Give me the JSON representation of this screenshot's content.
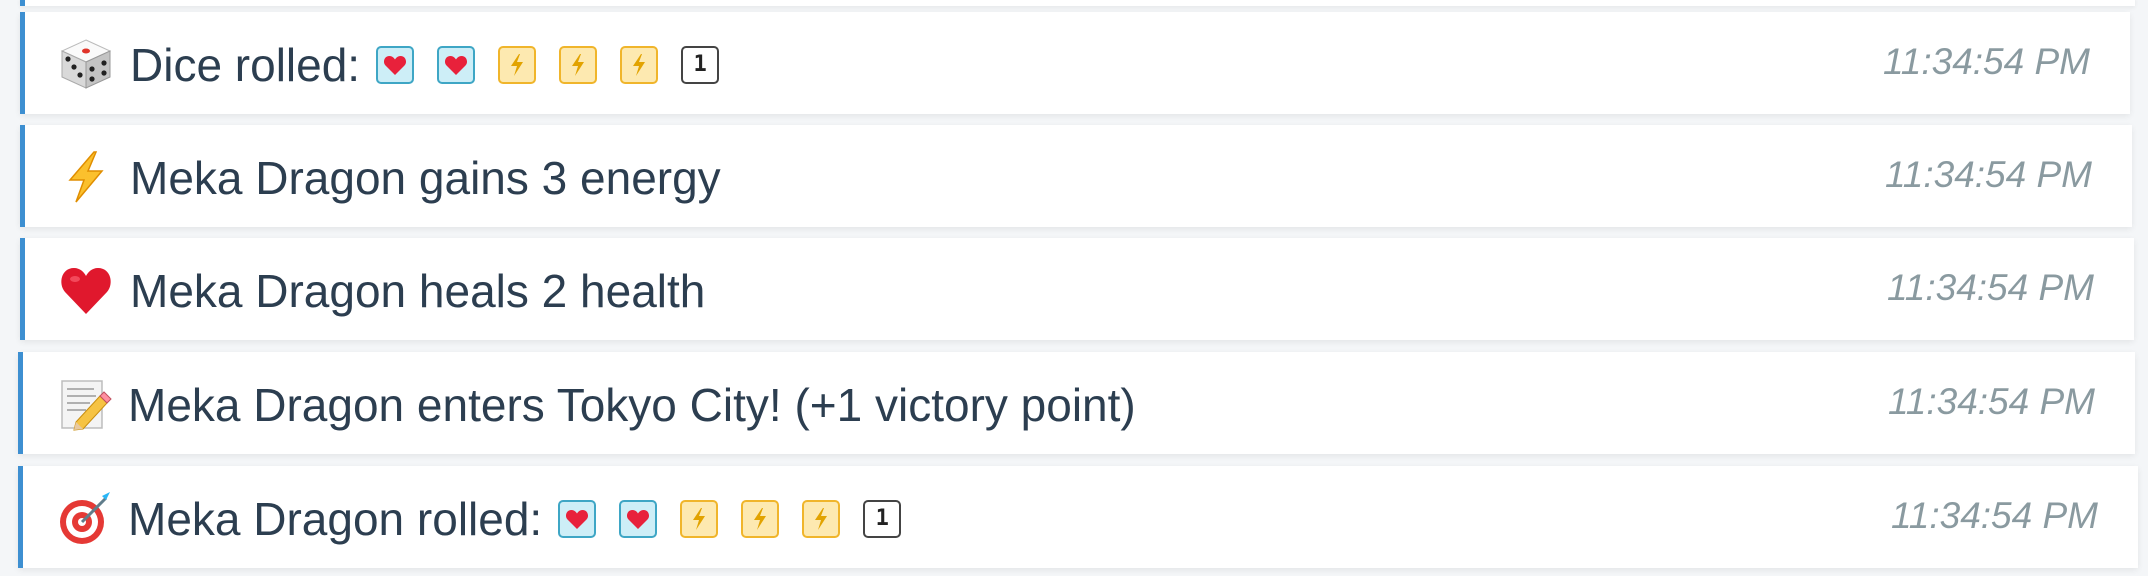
{
  "log": {
    "entries": [
      {
        "icon": "dice-icon",
        "text": "Dice rolled:",
        "dice": [
          "heart",
          "heart",
          "energy",
          "energy",
          "energy",
          "1"
        ],
        "time": "11:34:54 PM"
      },
      {
        "icon": "lightning-icon",
        "text": "Meka Dragon gains 3 energy",
        "dice": [],
        "time": "11:34:54 PM"
      },
      {
        "icon": "heart-icon",
        "text": "Meka Dragon heals 2 health",
        "dice": [],
        "time": "11:34:54 PM"
      },
      {
        "icon": "memo-icon",
        "text": "Meka Dragon enters Tokyo City! (+1 victory point)",
        "dice": [],
        "time": "11:34:54 PM"
      },
      {
        "icon": "target-icon",
        "text": "Meka Dragon rolled:",
        "dice": [
          "heart",
          "heart",
          "energy",
          "energy",
          "energy",
          "1"
        ],
        "time": "11:34:54 PM"
      }
    ],
    "die_number_label": "1",
    "colors": {
      "accent_border": "#3d8fd1",
      "heart_die_bg": "#cdeef7",
      "energy_die_bg": "#fde9b0",
      "timestamp": "#8a9aa0"
    }
  }
}
